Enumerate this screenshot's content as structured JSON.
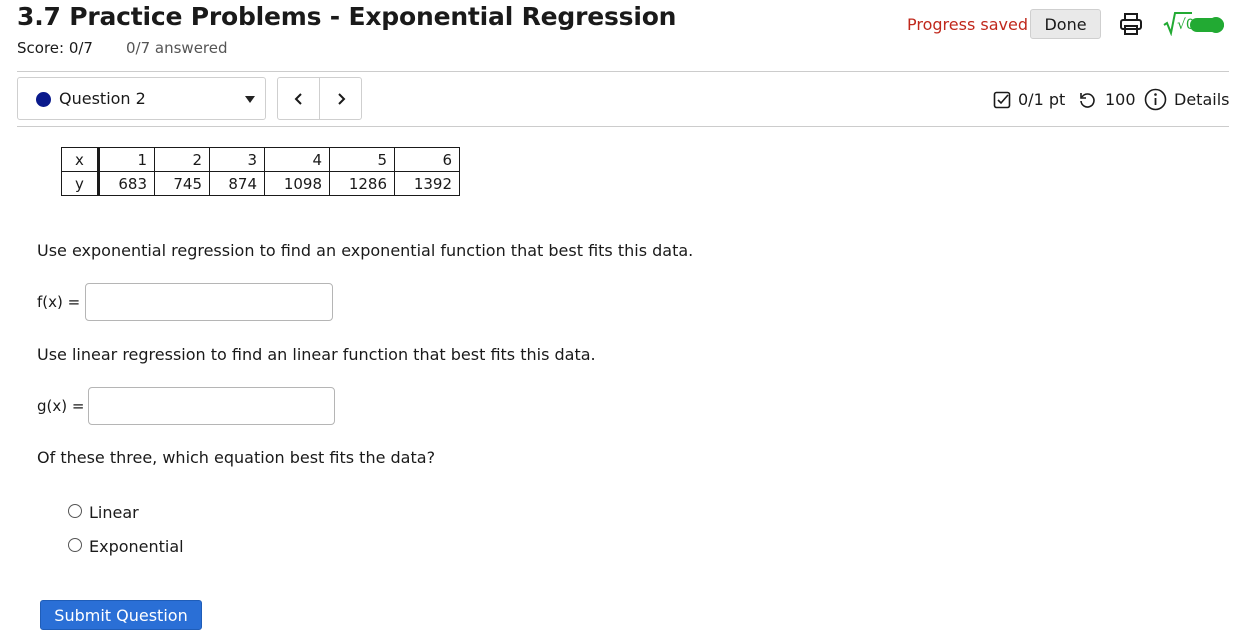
{
  "header": {
    "title": "3.7 Practice Problems - Exponential Regression",
    "score": "Score: 0/7",
    "answered": "0/7 answered",
    "progress_saved": "Progress saved",
    "done_label": "Done",
    "math_toggle_label": "√0",
    "math_toggle_on": true
  },
  "question_bar": {
    "question_label": "Question 2",
    "prev_label": "<",
    "next_label": ">",
    "points": "0/1 pt",
    "attempts": "100",
    "details_label": "Details"
  },
  "table": {
    "x_header": "x",
    "y_header": "y",
    "x": [
      "1",
      "2",
      "3",
      "4",
      "5",
      "6"
    ],
    "y": [
      "683",
      "745",
      "874",
      "1098",
      "1286",
      "1392"
    ]
  },
  "problem": {
    "prompt_exp": "Use exponential regression to find an exponential function that best fits this data.",
    "f_label": "f(x) =",
    "f_value": "",
    "prompt_lin": "Use linear regression to find an linear function that best fits this data.",
    "g_label": "g(x) =",
    "g_value": "",
    "prompt_best": "Of these three, which equation best fits the data?",
    "options": [
      "Linear",
      "Exponential"
    ],
    "submit_label": "Submit Question"
  },
  "colors": {
    "progress_saved": "#c0281c",
    "question_dot": "#0a1a8c",
    "toggle": "#22aa33",
    "submit": "#2a6fd6"
  }
}
